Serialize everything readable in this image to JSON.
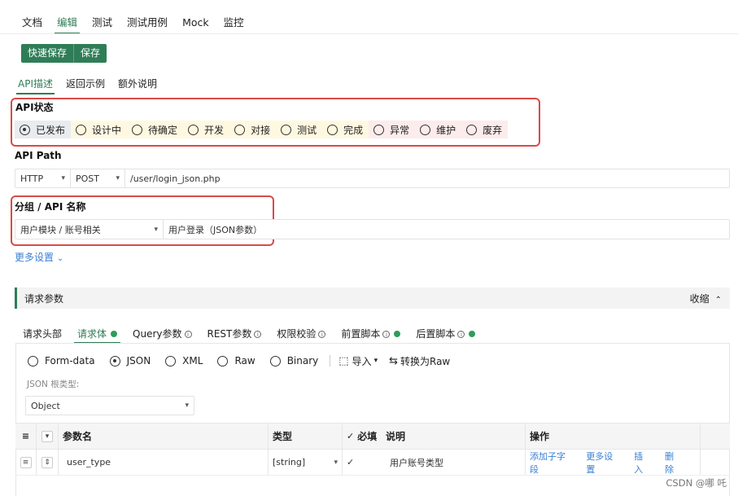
{
  "top_tabs": [
    "文档",
    "编辑",
    "测试",
    "测试用例",
    "Mock",
    "监控"
  ],
  "save": {
    "quick_save": "快速保存",
    "save": "保存"
  },
  "sub_tabs": [
    "API描述",
    "返回示例",
    "额外说明"
  ],
  "api_status": {
    "label": "API状态",
    "options": [
      {
        "label": "已发布",
        "selected": true,
        "bg": "#e9ecef"
      },
      {
        "label": "设计中",
        "selected": false,
        "bg": "#fff8e1"
      },
      {
        "label": "待确定",
        "selected": false,
        "bg": "#fff8e1"
      },
      {
        "label": "开发",
        "selected": false,
        "bg": "#fff8e1"
      },
      {
        "label": "对接",
        "selected": false,
        "bg": "#fff8e1"
      },
      {
        "label": "测试",
        "selected": false,
        "bg": "#fff8e1"
      },
      {
        "label": "完成",
        "selected": false,
        "bg": "#fff8e1"
      },
      {
        "label": "异常",
        "selected": false,
        "bg": "#fdecec"
      },
      {
        "label": "维护",
        "selected": false,
        "bg": "#fdecec"
      },
      {
        "label": "废弃",
        "selected": false,
        "bg": "#fdecec"
      }
    ]
  },
  "api_path": {
    "label": "API Path",
    "protocol": "HTTP",
    "method": "POST",
    "path": "/user/login_json.php"
  },
  "group_name": {
    "label": "分组 / API 名称",
    "group": "用户模块 / 账号相关",
    "name": "用户登录（JSON参数）"
  },
  "more_settings": "更多设置",
  "request_params": {
    "title": "请求参数",
    "collapse": "收缩"
  },
  "param_tabs": [
    {
      "label": "请求头部",
      "info": false,
      "dot": false
    },
    {
      "label": "请求体",
      "info": false,
      "dot": true
    },
    {
      "label": "Query参数",
      "info": true,
      "dot": false
    },
    {
      "label": "REST参数",
      "info": true,
      "dot": false
    },
    {
      "label": "权限校验",
      "info": true,
      "dot": false
    },
    {
      "label": "前置脚本",
      "info": true,
      "dot": true
    },
    {
      "label": "后置脚本",
      "info": true,
      "dot": true
    }
  ],
  "body_types": [
    {
      "label": "Form-data",
      "selected": false
    },
    {
      "label": "JSON",
      "selected": true
    },
    {
      "label": "XML",
      "selected": false
    },
    {
      "label": "Raw",
      "selected": false
    },
    {
      "label": "Binary",
      "selected": false
    }
  ],
  "import_label": "导入",
  "convert_label": "转换为Raw",
  "json_root": {
    "label": "JSON 根类型:",
    "value": "Object"
  },
  "table": {
    "headers": {
      "name": "参数名",
      "type": "类型",
      "required": "必填",
      "desc": "说明",
      "ops": "操作"
    },
    "rows": [
      {
        "name": "user_type",
        "type": "[string]",
        "desc": "用户账号类型",
        "ops": [
          "添加子字段",
          "更多设置",
          "插入",
          "删除"
        ]
      }
    ]
  },
  "watermark": "CSDN @哪 吒"
}
